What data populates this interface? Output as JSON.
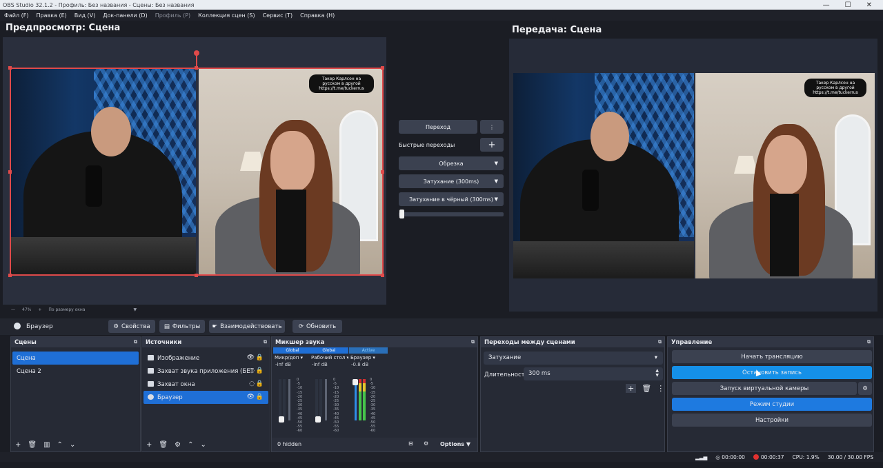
{
  "window": {
    "title": "OBS Studio 32.1.2 - Профиль: Без названия - Сцены: Без названия"
  },
  "menu": [
    {
      "label": "Файл (F)",
      "enabled": true
    },
    {
      "label": "Правка (E)",
      "enabled": true
    },
    {
      "label": "Вид (V)",
      "enabled": true
    },
    {
      "label": "Док-панели (D)",
      "enabled": true
    },
    {
      "label": "Профиль (P)",
      "enabled": false
    },
    {
      "label": "Коллекция сцен (S)",
      "enabled": true
    },
    {
      "label": "Сервис (T)",
      "enabled": true
    },
    {
      "label": "Справка (H)",
      "enabled": true
    }
  ],
  "preview": {
    "title": "Предпросмотр: Сцена",
    "zoom": "47%",
    "fit_label": "По размеру окна"
  },
  "program": {
    "title": "Передача: Сцена"
  },
  "overlay_caption": "Такер Карлсон на русском в другой https://t.me/tuckerrus",
  "transitions_center": {
    "transition_button": "Переход",
    "quick_label": "Быстрые переходы",
    "items": [
      "Обрезка",
      "Затухание (300ms)",
      "Затухание в чёрный (300ms)"
    ],
    "slider_value": 0
  },
  "source_toolbar": {
    "name": "Браузер",
    "properties": "Свойства",
    "filters": "Фильтры",
    "interact": "Взаимодействовать",
    "refresh": "Обновить"
  },
  "scenes": {
    "title": "Сцены",
    "items": [
      "Сцена",
      "Сцена 2"
    ],
    "selected": 0
  },
  "sources": {
    "title": "Источники",
    "items": [
      {
        "label": "Изображение",
        "visible": true,
        "selected": false
      },
      {
        "label": "Захват звука приложения (БЕТ",
        "visible": false,
        "selected": false
      },
      {
        "label": "Захват окна",
        "visible": false,
        "selected": false
      },
      {
        "label": "Браузер",
        "visible": true,
        "selected": true
      }
    ]
  },
  "mixer": {
    "title": "Микшер звука",
    "channels": [
      {
        "tag": "Global",
        "name": "Микр/доп",
        "db": "-inf dB",
        "level": 0,
        "muted": true
      },
      {
        "tag": "Global",
        "name": "Рабочий стол",
        "db": "-inf dB",
        "level": 0,
        "muted": true
      },
      {
        "tag": "Active",
        "name": "Браузер",
        "db": "-0.8 dB",
        "level": 0.92,
        "muted": false
      }
    ],
    "scale": [
      "0",
      "-5",
      "-10",
      "-15",
      "-20",
      "-25",
      "-30",
      "-35",
      "-40",
      "-45",
      "-50",
      "-55",
      "-60"
    ],
    "hidden": "0 hidden",
    "options": "Options"
  },
  "scene_transitions": {
    "title": "Переходы между сценами",
    "type": "Затухание",
    "duration_label": "Длительность",
    "duration": "300 ms"
  },
  "controls": {
    "title": "Управление",
    "start_stream": "Начать трансляцию",
    "stop_record": "Остановить запись",
    "virtual_cam": "Запуск виртуальной камеры",
    "studio": "Режим студии",
    "settings": "Настройки"
  },
  "status": {
    "stream_time": "00:00:00",
    "rec_time": "00:00:37",
    "cpu": "CPU: 1.9%",
    "fps": "30.00 / 30.00 FPS"
  },
  "colors": {
    "accent": "#1e7ae0",
    "selection": "#e04a4a",
    "panel": "#262a35"
  }
}
